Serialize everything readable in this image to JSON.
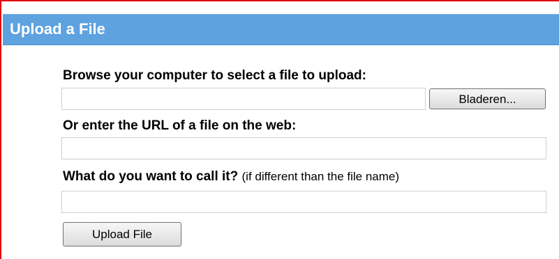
{
  "header": {
    "title": "Upload a File"
  },
  "browse": {
    "label": "Browse your computer to select a file to upload:",
    "value": "",
    "button_label": "Bladeren..."
  },
  "url": {
    "label": "Or enter the URL of a file on the web:",
    "value": ""
  },
  "name": {
    "label": "What do you want to call it?",
    "hint": "(if different than the file name)",
    "value": ""
  },
  "submit": {
    "label": "Upload File"
  },
  "colors": {
    "header_background": "#5ea2df",
    "frame_border": "#e0000b",
    "header_text": "#ffffff"
  }
}
